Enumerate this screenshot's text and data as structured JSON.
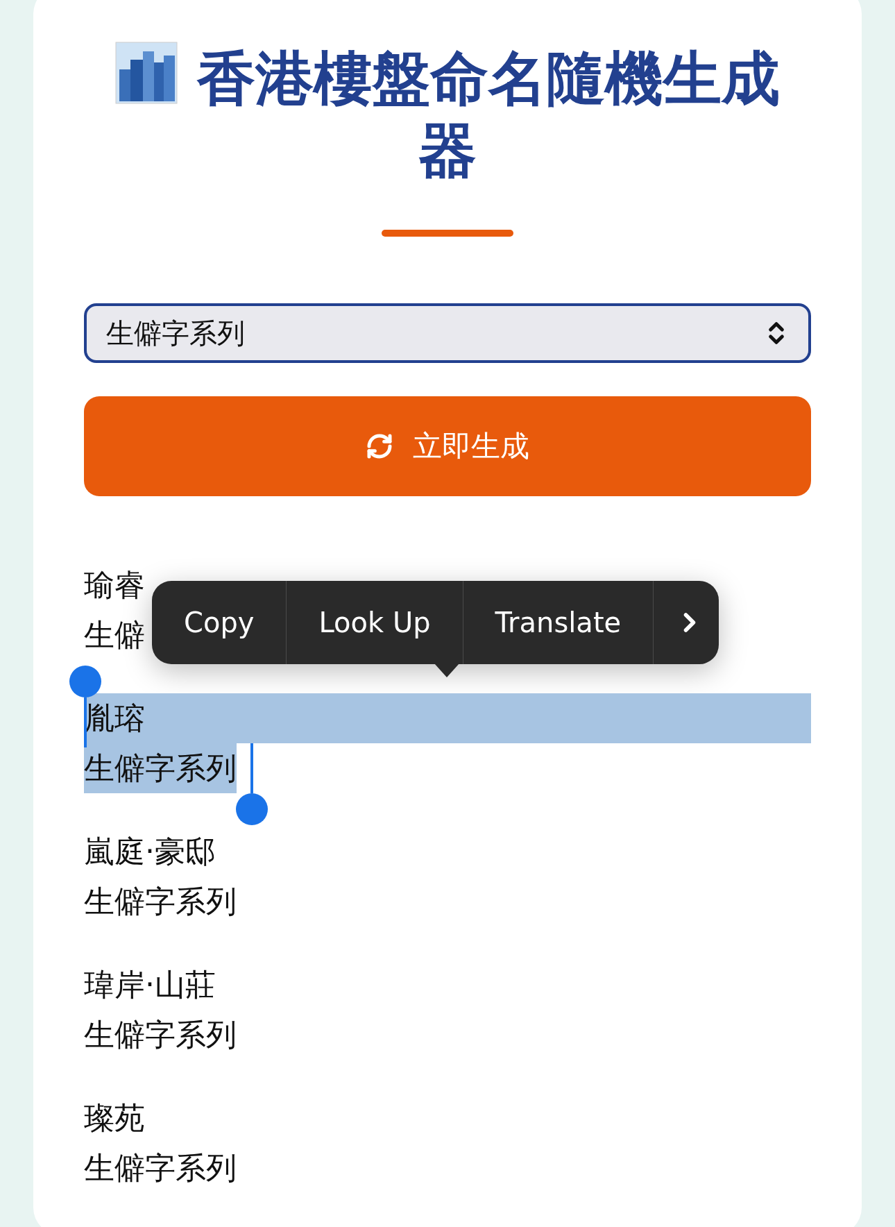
{
  "header": {
    "title": "香港樓盤命名隨機生成器"
  },
  "series_select": {
    "value": "生僻字系列"
  },
  "generate_button": {
    "label": "立即生成"
  },
  "results": [
    {
      "name": "瑜睿",
      "series": "生僻",
      "selected": false
    },
    {
      "name": "胤瑢",
      "series": "生僻字系列",
      "selected": true
    },
    {
      "name": "嵐庭·豪邸",
      "series": "生僻字系列",
      "selected": false
    },
    {
      "name": "瑋岸·山莊",
      "series": "生僻字系列",
      "selected": false
    },
    {
      "name": "璨苑",
      "series": "生僻字系列",
      "selected": false
    }
  ],
  "context_menu": {
    "items": [
      {
        "label": "Copy"
      },
      {
        "label": "Look Up"
      },
      {
        "label": "Translate"
      }
    ]
  }
}
